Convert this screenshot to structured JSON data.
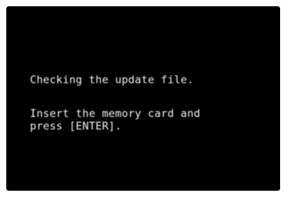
{
  "screen": {
    "background": "#000000",
    "text_color": "#f2f2f2",
    "status_message": "Checking the update file.",
    "instruction_line_1": "Insert the memory card and",
    "instruction_line_2": "press [ENTER]."
  }
}
